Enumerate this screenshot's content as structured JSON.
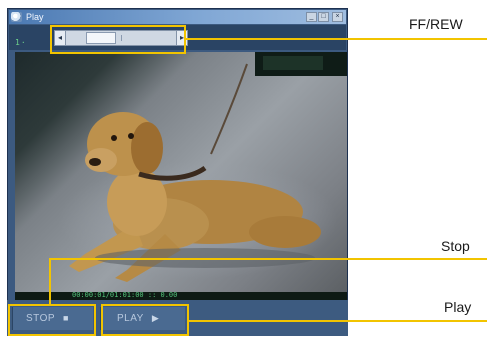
{
  "window": {
    "title": "Play",
    "counter": "1·",
    "status_text": "00:00:01/01:01:00 :: 0.00"
  },
  "controls": {
    "seek_position": 0.25,
    "stop_label": "STOP",
    "play_label": "PLAY"
  },
  "icons": {
    "app": "app-icon",
    "minimize": "minimize-icon",
    "maximize": "maximize-icon",
    "close": "close-icon",
    "rewind": "rewind-arrow-icon",
    "fastforward": "fastforward-arrow-icon",
    "stop": "stop-square-icon",
    "play": "play-triangle-icon"
  },
  "callouts": {
    "ffrew": "FF/REW",
    "stop": "Stop",
    "play": "Play",
    "color": "#f2c400"
  },
  "video": {
    "subject": "golden retriever lying on pavement"
  }
}
